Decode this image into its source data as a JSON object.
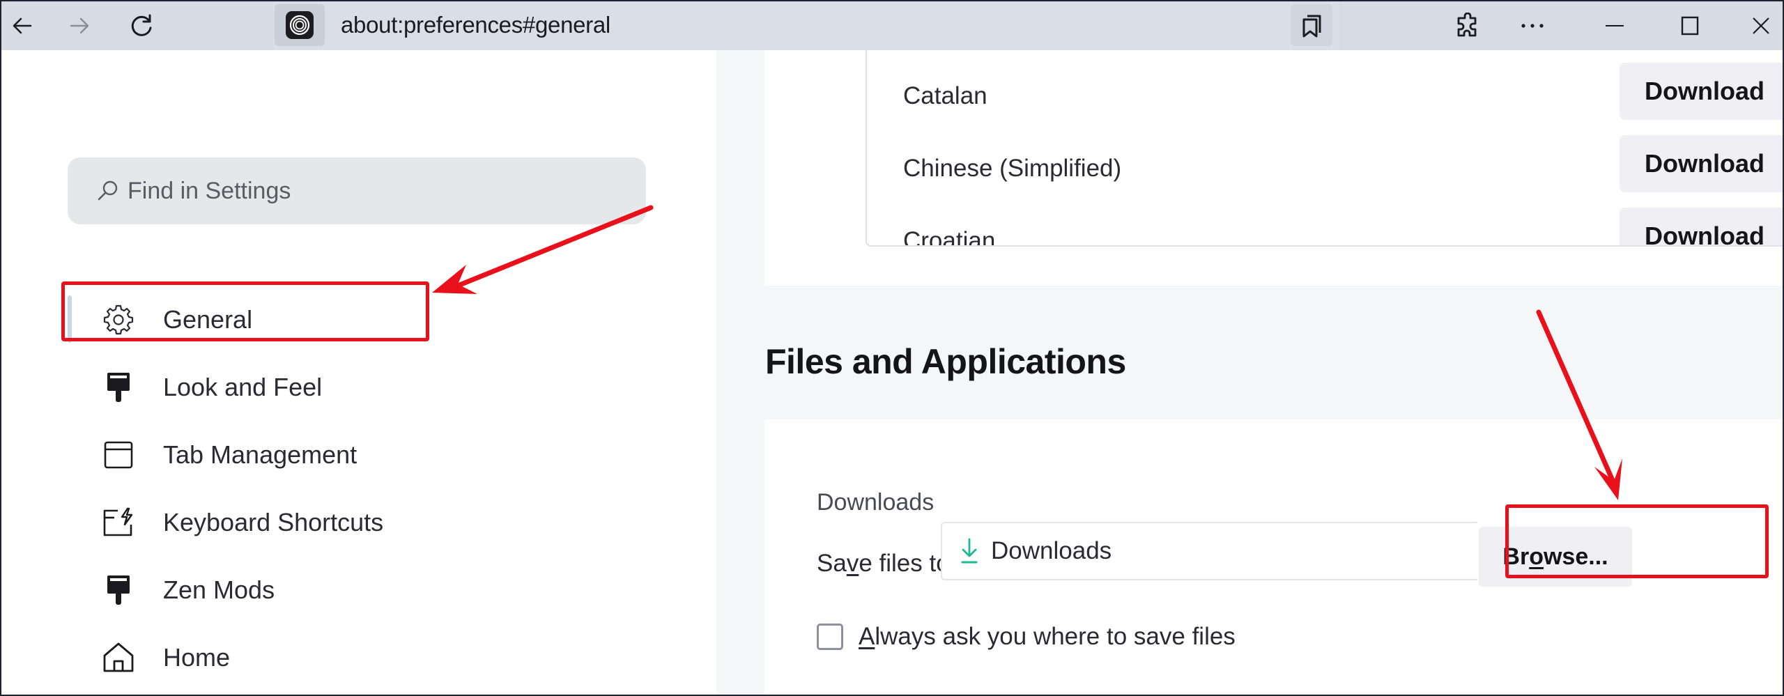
{
  "toolbar": {
    "back_icon": "arrow-left-icon",
    "forward_icon": "arrow-right-icon",
    "reload_icon": "reload-icon",
    "site_icon": "zen-browser-icon",
    "url": "about:preferences#general",
    "bookmarks_icon": "bookmarks-icon",
    "extensions_icon": "puzzle-icon",
    "menu_icon": "more-horizontal-icon",
    "window_controls": [
      "minimize-icon",
      "maximize-icon",
      "close-icon"
    ]
  },
  "sidebar": {
    "search": {
      "placeholder": "Find in Settings",
      "value": ""
    },
    "items": [
      {
        "label": "General",
        "icon": "gear-icon",
        "selected": true
      },
      {
        "label": "Look and Feel",
        "icon": "paintbrush-icon",
        "selected": false
      },
      {
        "label": "Tab Management",
        "icon": "window-icon",
        "selected": false
      },
      {
        "label": "Keyboard Shortcuts",
        "icon": "keyboard-shortcut-icon",
        "selected": false
      },
      {
        "label": "Zen Mods",
        "icon": "paintbrush-icon",
        "selected": false
      },
      {
        "label": "Home",
        "icon": "home-icon",
        "selected": false
      }
    ]
  },
  "languages": {
    "rows": [
      {
        "name": "Catalan",
        "action": "Download"
      },
      {
        "name": "Chinese (Simplified)",
        "action": "Download"
      },
      {
        "name": "Croatian",
        "action": "Download"
      }
    ]
  },
  "files_section": {
    "title": "Files and Applications",
    "downloads_heading": "Downloads",
    "save_files_to": {
      "before": "Sa",
      "access_key": "v",
      "after": "e files to"
    },
    "save_path": "Downloads",
    "browse": {
      "before": "Br",
      "access_key": "o",
      "after": "wse..."
    },
    "always_ask": {
      "access_key": "A",
      "after": "lways ask you where to save files",
      "checked": false
    }
  },
  "annotations": {
    "color": "#e8101a",
    "highlighted": [
      "General",
      "Browse..."
    ]
  },
  "colors": {
    "toolbar_bg": "#d6dbe4",
    "content_bg": "#f5f6f8",
    "download_icon": "#1fb894",
    "selected_indicator": "#c8d6ee"
  }
}
